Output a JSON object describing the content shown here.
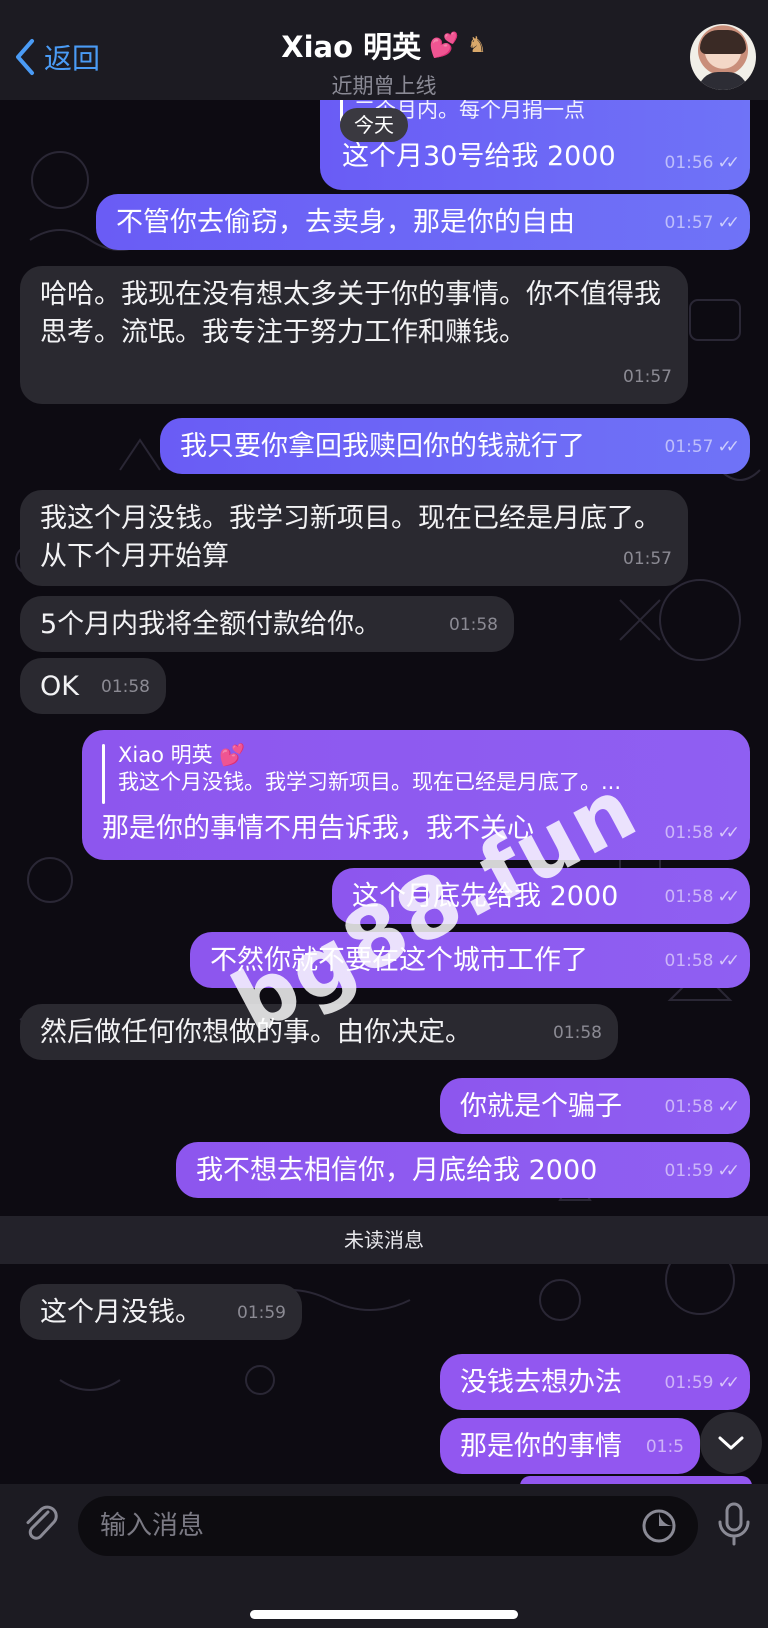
{
  "header": {
    "back_label": "返回",
    "contact_name": "Xiao 明英",
    "name_emoji": "💕",
    "status": "近期曾上线"
  },
  "date_pill": "今天",
  "messages": [
    {
      "dir": "out",
      "reply_hint": "三个月内。每个月捐一点",
      "text": "这个月30号给我 2000",
      "time": "01:56",
      "ticks": "✓✓"
    },
    {
      "dir": "out",
      "text": "不管你去偷窃，去卖身，那是你的自由",
      "time": "01:57",
      "ticks": "✓✓"
    },
    {
      "dir": "in",
      "text": "哈哈。我现在没有想太多关于你的事情。你不值得我思考。流氓。我专注于努力工作和赚钱。",
      "time": "01:57"
    },
    {
      "dir": "out",
      "text": "我只要你拿回我赎回你的钱就行了",
      "time": "01:57",
      "ticks": "✓✓"
    },
    {
      "dir": "in",
      "text": "我这个月没钱。我学习新项目。现在已经是月底了。从下个月开始算",
      "time": "01:57"
    },
    {
      "dir": "in",
      "text": "5个月内我将全额付款给你。",
      "time": "01:58"
    },
    {
      "dir": "in",
      "text": "OK",
      "time": "01:58"
    },
    {
      "dir": "out",
      "reply_name": "Xiao 明英 💕",
      "reply_text": "我这个月没钱。我学习新项目。现在已经是月底了。...",
      "text": "那是你的事情不用告诉我，我不关心",
      "time": "01:58",
      "ticks": "✓✓"
    },
    {
      "dir": "out",
      "text": "这个月底先给我 2000",
      "time": "01:58",
      "ticks": "✓✓"
    },
    {
      "dir": "out",
      "text": "不然你就不要在这个城市工作了",
      "time": "01:58",
      "ticks": "✓✓"
    },
    {
      "dir": "in",
      "text": "然后做任何你想做的事。由你决定。",
      "time": "01:58"
    },
    {
      "dir": "out",
      "text": "你就是个骗子",
      "time": "01:58",
      "ticks": "✓✓"
    },
    {
      "dir": "out",
      "text": "我不想去相信你，月底给我 2000",
      "time": "01:59",
      "ticks": "✓✓"
    },
    {
      "dir": "in",
      "text": "这个月没钱。",
      "time": "01:59"
    },
    {
      "dir": "out",
      "text": "没钱去想办法",
      "time": "01:59",
      "ticks": "✓✓"
    },
    {
      "dir": "out",
      "text": "那是你的事情",
      "time": "01:5",
      "ticks": ""
    }
  ],
  "unread_label": "未读消息",
  "input": {
    "placeholder": "输入消息"
  },
  "watermark": "bg88.fun",
  "colors": {
    "accent": "#4a9bf5",
    "bubble_in": "#2a2930",
    "bubble_out_blue": "#6a5cf5",
    "bubble_out_purple": "#9257f0",
    "background": "#0d0b12"
  }
}
